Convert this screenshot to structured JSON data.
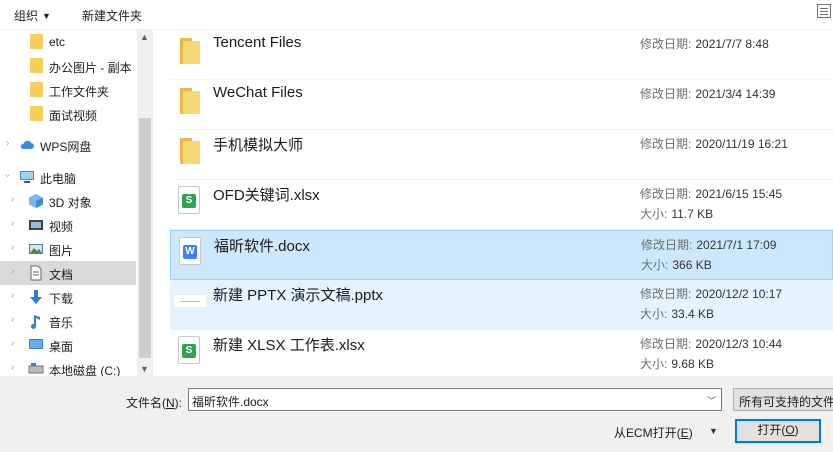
{
  "toolbar": {
    "organize_label": "组织",
    "new_folder_label": "新建文件夹"
  },
  "nav": {
    "items": [
      {
        "label": "etc",
        "icon": "folder-icon",
        "type": "folder"
      },
      {
        "label": "办公图片 - 副本",
        "icon": "folder-icon",
        "type": "folder"
      },
      {
        "label": "工作文件夹",
        "icon": "folder-icon",
        "type": "folder"
      },
      {
        "label": "面试视频",
        "icon": "folder-icon",
        "type": "folder"
      },
      {
        "label": "WPS网盘",
        "icon": "cloud-icon",
        "type": "root"
      },
      {
        "label": "此电脑",
        "icon": "computer-icon",
        "type": "root"
      },
      {
        "label": "3D 对象",
        "icon": "cube-icon",
        "type": "child"
      },
      {
        "label": "视频",
        "icon": "video-icon",
        "type": "child"
      },
      {
        "label": "图片",
        "icon": "image-icon",
        "type": "child"
      },
      {
        "label": "文档",
        "icon": "document-icon",
        "type": "child",
        "selected": true
      },
      {
        "label": "下载",
        "icon": "download-icon",
        "type": "child"
      },
      {
        "label": "音乐",
        "icon": "music-icon",
        "type": "child"
      },
      {
        "label": "桌面",
        "icon": "desktop-icon",
        "type": "child"
      },
      {
        "label": "本地磁盘 (C:)",
        "icon": "drive-icon",
        "type": "child"
      }
    ]
  },
  "files": {
    "modified_label": "修改日期:",
    "size_label": "大小:",
    "rows": [
      {
        "name": "Tencent Files",
        "kind": "folder",
        "modified": "2021/7/7 8:48",
        "size": ""
      },
      {
        "name": "WeChat Files",
        "kind": "folder",
        "modified": "2021/3/4 14:39",
        "size": ""
      },
      {
        "name": "手机模拟大师",
        "kind": "folder",
        "modified": "2020/11/19 16:21",
        "size": ""
      },
      {
        "name": "OFD关键词.xlsx",
        "kind": "xlsx",
        "modified": "2021/6/15 15:45",
        "size": "11.7 KB"
      },
      {
        "name": "福昕软件.docx",
        "kind": "docx",
        "modified": "2021/7/1 17:09",
        "size": "366 KB",
        "selected": true
      },
      {
        "name": "新建 PPTX 演示文稿.pptx",
        "kind": "pptx",
        "modified": "2020/12/2 10:17",
        "size": "33.4 KB",
        "hover": true
      },
      {
        "name": "新建 XLSX 工作表.xlsx",
        "kind": "xlsx",
        "modified": "2020/12/3 10:44",
        "size": "9.68 KB"
      }
    ]
  },
  "bottom": {
    "filename_label": "文件名(",
    "filename_key": "N",
    "filename_label_end": "):",
    "filename_value": "福昕软件.docx",
    "filter_value": "所有可支持的文件",
    "ecm_label": "从ECM打开(",
    "ecm_key": "E",
    "ecm_label_end": ")",
    "open_label": "打开(",
    "open_key": "O",
    "open_label_end": ")"
  },
  "colors": {
    "selected_row": "#cce8ff",
    "hover_row": "#e5f3ff",
    "accent": "#0078d7"
  }
}
